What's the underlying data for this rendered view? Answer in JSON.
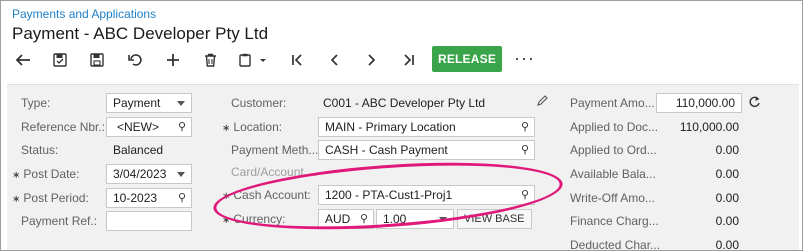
{
  "breadcrumb": "Payments and Applications",
  "title": "Payment - ABC Developer Pty Ltd",
  "toolbar": {
    "icons": [
      "back-icon",
      "save-close-icon",
      "save-icon",
      "undo-icon",
      "add-icon",
      "delete-icon",
      "copy-paste-icon",
      "first-record-icon",
      "previous-record-icon",
      "next-record-icon",
      "last-record-icon"
    ],
    "release_label": "RELEASE",
    "more": "···"
  },
  "left": {
    "type_label": "Type:",
    "type_value": "Payment",
    "ref_label": "Reference Nbr.:",
    "ref_value": "<NEW>",
    "status_label": "Status:",
    "status_value": "Balanced",
    "post_date_label": "Post Date:",
    "post_date_value": "3/04/2023",
    "post_period_label": "Post Period:",
    "post_period_value": "10-2023",
    "payment_ref_label": "Payment Ref.:",
    "payment_ref_value": ""
  },
  "middle": {
    "customer_label": "Customer:",
    "customer_value": "C001 - ABC Developer Pty Ltd",
    "location_label": "Location:",
    "location_value": "MAIN - Primary Location",
    "payment_method_label": "Payment Meth...",
    "payment_method_value": "CASH - Cash Payment",
    "card_account_label": "Card/Account ...",
    "cash_account_label": "Cash Account:",
    "cash_account_value": "1200 - PTA-Cust1-Proj1",
    "currency_label": "Currency:",
    "currency_value": "AUD",
    "rate_value": "1.00",
    "view_base_label": "VIEW BASE"
  },
  "right": {
    "rows": [
      {
        "label": "Payment Amo...",
        "value": "110,000.00"
      },
      {
        "label": "Applied to Doc...",
        "value": "110,000.00"
      },
      {
        "label": "Applied to Ord...",
        "value": "0.00"
      },
      {
        "label": "Available Bala...",
        "value": "0.00"
      },
      {
        "label": "Write-Off Amo...",
        "value": "0.00"
      },
      {
        "label": "Finance Charg...",
        "value": "0.00"
      },
      {
        "label": "Deducted Char...",
        "value": "0.00"
      }
    ]
  },
  "colors": {
    "link": "#1e7fc7",
    "release": "#3aa44a",
    "highlight": "#e0187a"
  }
}
